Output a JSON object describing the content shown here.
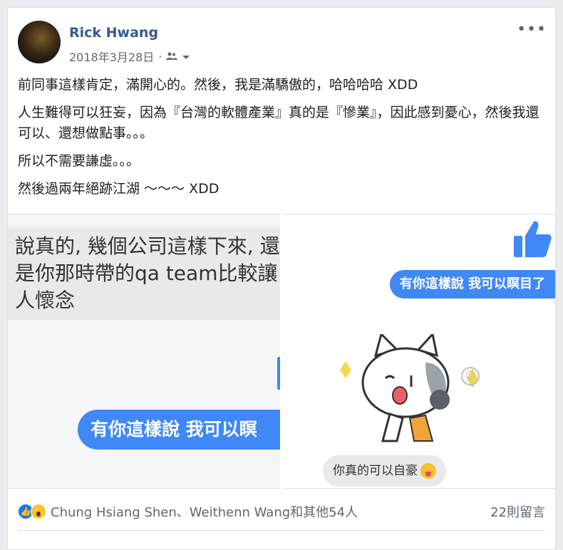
{
  "post": {
    "author": "Rick Hwang",
    "date": "2018年3月28日",
    "separator": "·",
    "privacy_icon": "friends-icon",
    "paragraphs": [
      "前同事這樣肯定，滿開心的。然後，我是滿驕傲的，哈哈哈哈 XDD",
      "人生難得可以狂妄，因為『台灣的軟體產業』真的是『慘業』，因此感到憂心，然後我還可以、還想做點事。。。",
      "所以不需要謙虛。。。",
      "然後過兩年絕跡江湖 ～～～ XDD"
    ]
  },
  "photo_left": {
    "gray_bubble": "說真的, 幾個公司這樣下來, 還是你那時帶的qa team比較讓人懷念",
    "blue_bubble": "有你這樣說 我可以瞑"
  },
  "photo_right": {
    "blue_bubble": "有你這樣說 我可以瞑目了",
    "gray_bubble": "你真的可以自豪"
  },
  "footer": {
    "reactors": "Chung Hsiang Shen、Weithenn Wang和其他54人",
    "comments": "22則留言"
  },
  "colors": {
    "link": "#385898",
    "messenger_blue": "#3f88f5",
    "like_blue": "#1877f2"
  }
}
